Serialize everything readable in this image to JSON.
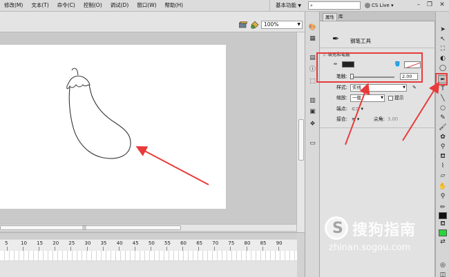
{
  "menu": {
    "items": [
      "修改(M)",
      "文本(T)",
      "命令(C)",
      "控制(O)",
      "调试(D)",
      "窗口(W)",
      "帮助(H)"
    ],
    "workspace": "基本功能",
    "search_placeholder": "",
    "cs_live": "CS Live"
  },
  "stage": {
    "zoom": "100%"
  },
  "timeline": {
    "ruler_numbers": [
      "5",
      "10",
      "15",
      "20",
      "25",
      "30",
      "35",
      "40",
      "45",
      "50",
      "55",
      "60",
      "65",
      "70",
      "75",
      "80",
      "85",
      "90"
    ]
  },
  "panel": {
    "tabs": [
      "属性",
      "库"
    ],
    "tool_name": "钢笔工具",
    "section_fill_stroke": "填充和笔触",
    "stroke_label": "笔触:",
    "stroke_value": "2.00",
    "style_label": "样式:",
    "style_value": "实线",
    "scale_label": "缩放:",
    "scale_value": "一般",
    "hint_label": "提示",
    "cap_label": "端点:",
    "join_label": "接合:",
    "miter_label": "尖角:",
    "miter_value": "3.00"
  },
  "watermark": {
    "text": "搜狗指南",
    "url": "zhinan.sogou.com"
  },
  "colors": {
    "annotation": "#e83a3a",
    "fill_color": "#29d63a",
    "stroke_color": "#222222"
  }
}
